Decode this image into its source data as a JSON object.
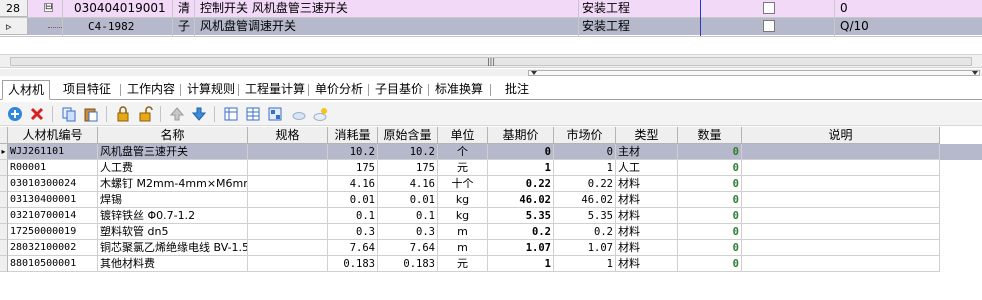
{
  "top_grid": {
    "rows": [
      {
        "num": "28",
        "expander": "⊟",
        "code": "030404019001",
        "type": "清",
        "name": "控制开关 风机盘管三速开关",
        "category": "安装工程",
        "qty": "0"
      },
      {
        "num": "▹",
        "code": "C4-1982",
        "type": "子",
        "name": "风机盘管调速开关",
        "category": "安装工程",
        "qty": "Q/10"
      }
    ]
  },
  "scrollbar": {
    "thumb_glyph": "|||"
  },
  "tabs": [
    "人材机",
    "项目特征",
    "工作内容",
    "计算规则",
    "工程量计算",
    "单价分析",
    "子目基价",
    "标准换算",
    "批注"
  ],
  "toolbar": {
    "icons": [
      "add-icon",
      "delete-icon",
      "copy-icon",
      "paste-icon",
      "lock-icon",
      "unlock-icon",
      "move-up-icon",
      "move-down-icon",
      "grid-a-icon",
      "grid-b-icon",
      "grid-c-icon",
      "cloud-sun-icon",
      "weather-icon"
    ]
  },
  "materials": {
    "headers": [
      "人材机编号",
      "名称",
      "规格",
      "消耗量",
      "原始含量",
      "单位",
      "基期价",
      "市场价",
      "类型",
      "数量",
      "说明"
    ],
    "rows": [
      [
        "WJJ261101",
        "风机盘管三速开关",
        "",
        "10.2",
        "10.2",
        "个",
        "0",
        "0",
        "主材",
        "0",
        ""
      ],
      [
        "R00001",
        "人工费",
        "",
        "175",
        "175",
        "元",
        "1",
        "1",
        "人工",
        "0",
        ""
      ],
      [
        "03010300024",
        "木螺钉 M2mm-4mm×M6mm-65mm",
        "",
        "4.16",
        "4.16",
        "十个",
        "0.22",
        "0.22",
        "材料",
        "0",
        ""
      ],
      [
        "03130400001",
        "焊锡",
        "",
        "0.01",
        "0.01",
        "kg",
        "46.02",
        "46.02",
        "材料",
        "0",
        ""
      ],
      [
        "03210700014",
        "镀锌铁丝 Φ0.7-1.2",
        "",
        "0.1",
        "0.1",
        "kg",
        "5.35",
        "5.35",
        "材料",
        "0",
        ""
      ],
      [
        "17250000019",
        "塑料软管 dn5",
        "",
        "0.3",
        "0.3",
        "m",
        "0.2",
        "0.2",
        "材料",
        "0",
        ""
      ],
      [
        "28032100002",
        "铜芯聚氯乙烯绝缘电线 BV-1.5",
        "",
        "7.64",
        "7.64",
        "m",
        "1.07",
        "1.07",
        "材料",
        "0",
        ""
      ],
      [
        "88010500001",
        "其他材料费",
        "",
        "0.183",
        "0.183",
        "元",
        "1",
        "1",
        "材料",
        "0",
        ""
      ]
    ]
  }
}
